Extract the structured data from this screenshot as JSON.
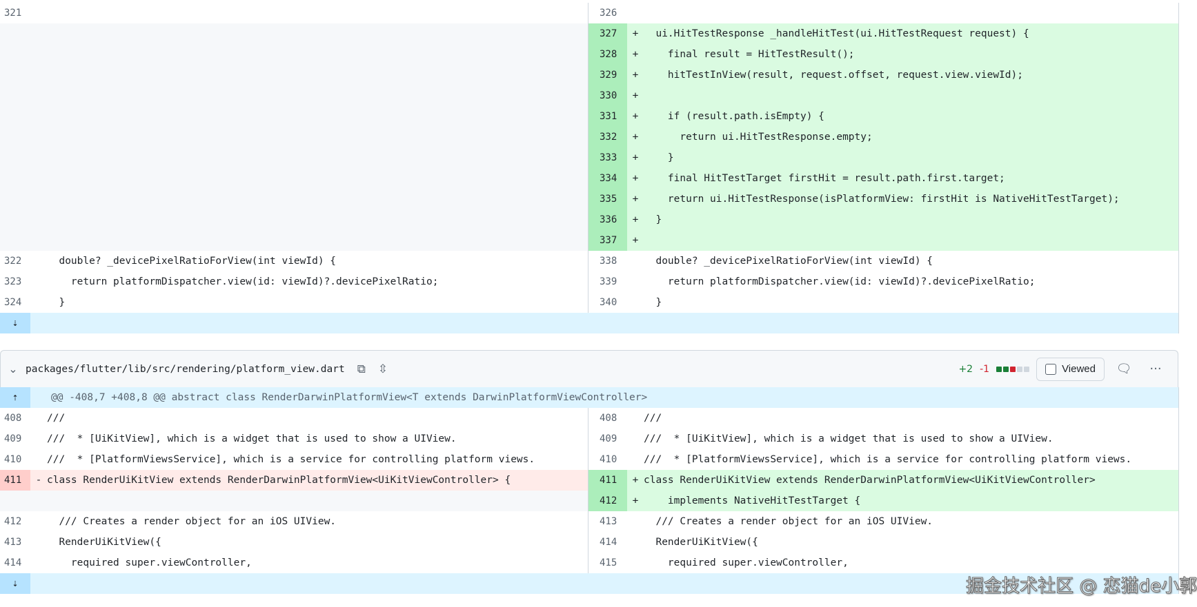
{
  "diff1": {
    "rows": [
      {
        "type": "ctx",
        "ln": "321",
        "rn": "326",
        "lcode": "",
        "rcode": ""
      },
      {
        "type": "add",
        "ln": "",
        "rn": "327",
        "lcode": "",
        "rcode": "  ui.HitTestResponse _handleHitTest(ui.HitTestRequest request) {"
      },
      {
        "type": "add",
        "ln": "",
        "rn": "328",
        "lcode": "",
        "rcode": "    final result = HitTestResult();"
      },
      {
        "type": "add",
        "ln": "",
        "rn": "329",
        "lcode": "",
        "rcode": "    hitTestInView(result, request.offset, request.view.viewId);"
      },
      {
        "type": "add",
        "ln": "",
        "rn": "330",
        "lcode": "",
        "rcode": ""
      },
      {
        "type": "add",
        "ln": "",
        "rn": "331",
        "lcode": "",
        "rcode": "    if (result.path.isEmpty) {"
      },
      {
        "type": "add",
        "ln": "",
        "rn": "332",
        "lcode": "",
        "rcode": "      return ui.HitTestResponse.empty;"
      },
      {
        "type": "add",
        "ln": "",
        "rn": "333",
        "lcode": "",
        "rcode": "    }"
      },
      {
        "type": "add",
        "ln": "",
        "rn": "334",
        "lcode": "",
        "rcode": "    final HitTestTarget firstHit = result.path.first.target;"
      },
      {
        "type": "add",
        "ln": "",
        "rn": "335",
        "lcode": "",
        "rcode": "    return ui.HitTestResponse(isPlatformView: firstHit is NativeHitTestTarget);"
      },
      {
        "type": "add",
        "ln": "",
        "rn": "336",
        "lcode": "",
        "rcode": "  }"
      },
      {
        "type": "add",
        "ln": "",
        "rn": "337",
        "lcode": "",
        "rcode": ""
      },
      {
        "type": "ctx",
        "ln": "322",
        "rn": "338",
        "lcode": "  double? _devicePixelRatioForView(int viewId) {",
        "rcode": "  double? _devicePixelRatioForView(int viewId) {"
      },
      {
        "type": "ctx",
        "ln": "323",
        "rn": "339",
        "lcode": "    return platformDispatcher.view(id: viewId)?.devicePixelRatio;",
        "rcode": "    return platformDispatcher.view(id: viewId)?.devicePixelRatio;"
      },
      {
        "type": "ctx",
        "ln": "324",
        "rn": "340",
        "lcode": "  }",
        "rcode": "  }"
      }
    ]
  },
  "file": {
    "path": "packages/flutter/lib/src/rendering/platform_view.dart",
    "additions": "+2",
    "deletions": "-1",
    "viewed_label": "Viewed",
    "hunk_header": "@@ -408,7 +408,8 @@ abstract class RenderDarwinPlatformView<T extends DarwinPlatformViewController>"
  },
  "diff2": {
    "rows": [
      {
        "type": "ctx",
        "ln": "408",
        "rn": "408",
        "lcode": "///",
        "rcode": "///"
      },
      {
        "type": "ctx",
        "ln": "409",
        "rn": "409",
        "lcode": "///  * [UiKitView], which is a widget that is used to show a UIView.",
        "rcode": "///  * [UiKitView], which is a widget that is used to show a UIView."
      },
      {
        "type": "ctx",
        "ln": "410",
        "rn": "410",
        "lcode": "///  * [PlatformViewsService], which is a service for controlling platform views.",
        "rcode": "///  * [PlatformViewsService], which is a service for controlling platform views."
      },
      {
        "type": "mod",
        "ln": "411",
        "rn": "411",
        "lcode": "class RenderUiKitView extends RenderDarwinPlatformView<UiKitViewController> {",
        "rcode": "class RenderUiKitView extends RenderDarwinPlatformView<UiKitViewController>"
      },
      {
        "type": "add",
        "ln": "",
        "rn": "412",
        "lcode": "",
        "rcode": "    implements NativeHitTestTarget {"
      },
      {
        "type": "ctx",
        "ln": "412",
        "rn": "413",
        "lcode": "  /// Creates a render object for an iOS UIView.",
        "rcode": "  /// Creates a render object for an iOS UIView."
      },
      {
        "type": "ctx",
        "ln": "413",
        "rn": "414",
        "lcode": "  RenderUiKitView({",
        "rcode": "  RenderUiKitView({"
      },
      {
        "type": "ctx",
        "ln": "414",
        "rn": "415",
        "lcode": "    required super.viewController,",
        "rcode": "    required super.viewController,"
      }
    ]
  },
  "watermark": "掘金技术社区 @ 恋猫de小郭",
  "colors": {
    "add_bg": "#dafbe1",
    "del_bg": "#ffebe9",
    "hunk_bg": "#ddf4ff",
    "add_block": "#1a7f37",
    "del_block": "#d1242f"
  }
}
